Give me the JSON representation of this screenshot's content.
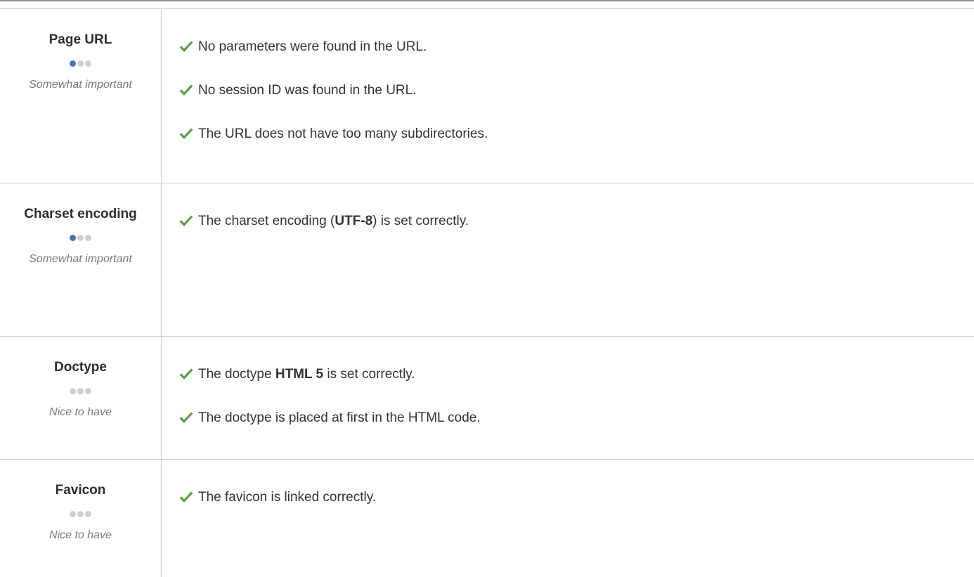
{
  "colors": {
    "check_green": "#5e9f4e",
    "dot_active": "#4d6fb3",
    "dot_inactive": "#cfcfcf",
    "divider": "#cccccc"
  },
  "rows": [
    {
      "title": "Page URL",
      "importance": "Somewhat important",
      "importance_level": 1,
      "results": [
        {
          "icon": "check-icon",
          "before": "No parameters were found in the URL.",
          "bold": "",
          "after": ""
        },
        {
          "icon": "check-icon",
          "before": "No session ID was found in the URL.",
          "bold": "",
          "after": ""
        },
        {
          "icon": "check-icon",
          "before": "The URL does not have too many subdirectories.",
          "bold": "",
          "after": ""
        }
      ]
    },
    {
      "title": "Charset encoding",
      "importance": "Somewhat important",
      "importance_level": 1,
      "results": [
        {
          "icon": "check-icon",
          "before": "The charset encoding (",
          "bold": "UTF-8",
          "after": ") is set correctly."
        }
      ]
    },
    {
      "title": "Doctype",
      "importance": "Nice to have",
      "importance_level": 0,
      "results": [
        {
          "icon": "check-icon",
          "before": "The doctype ",
          "bold": "HTML 5",
          "after": " is set correctly."
        },
        {
          "icon": "check-icon",
          "before": "The doctype is placed at first in the HTML code.",
          "bold": "",
          "after": ""
        }
      ]
    },
    {
      "title": "Favicon",
      "importance": "Nice to have",
      "importance_level": 0,
      "results": [
        {
          "icon": "check-icon",
          "before": "The favicon is linked correctly.",
          "bold": "",
          "after": ""
        }
      ]
    }
  ]
}
